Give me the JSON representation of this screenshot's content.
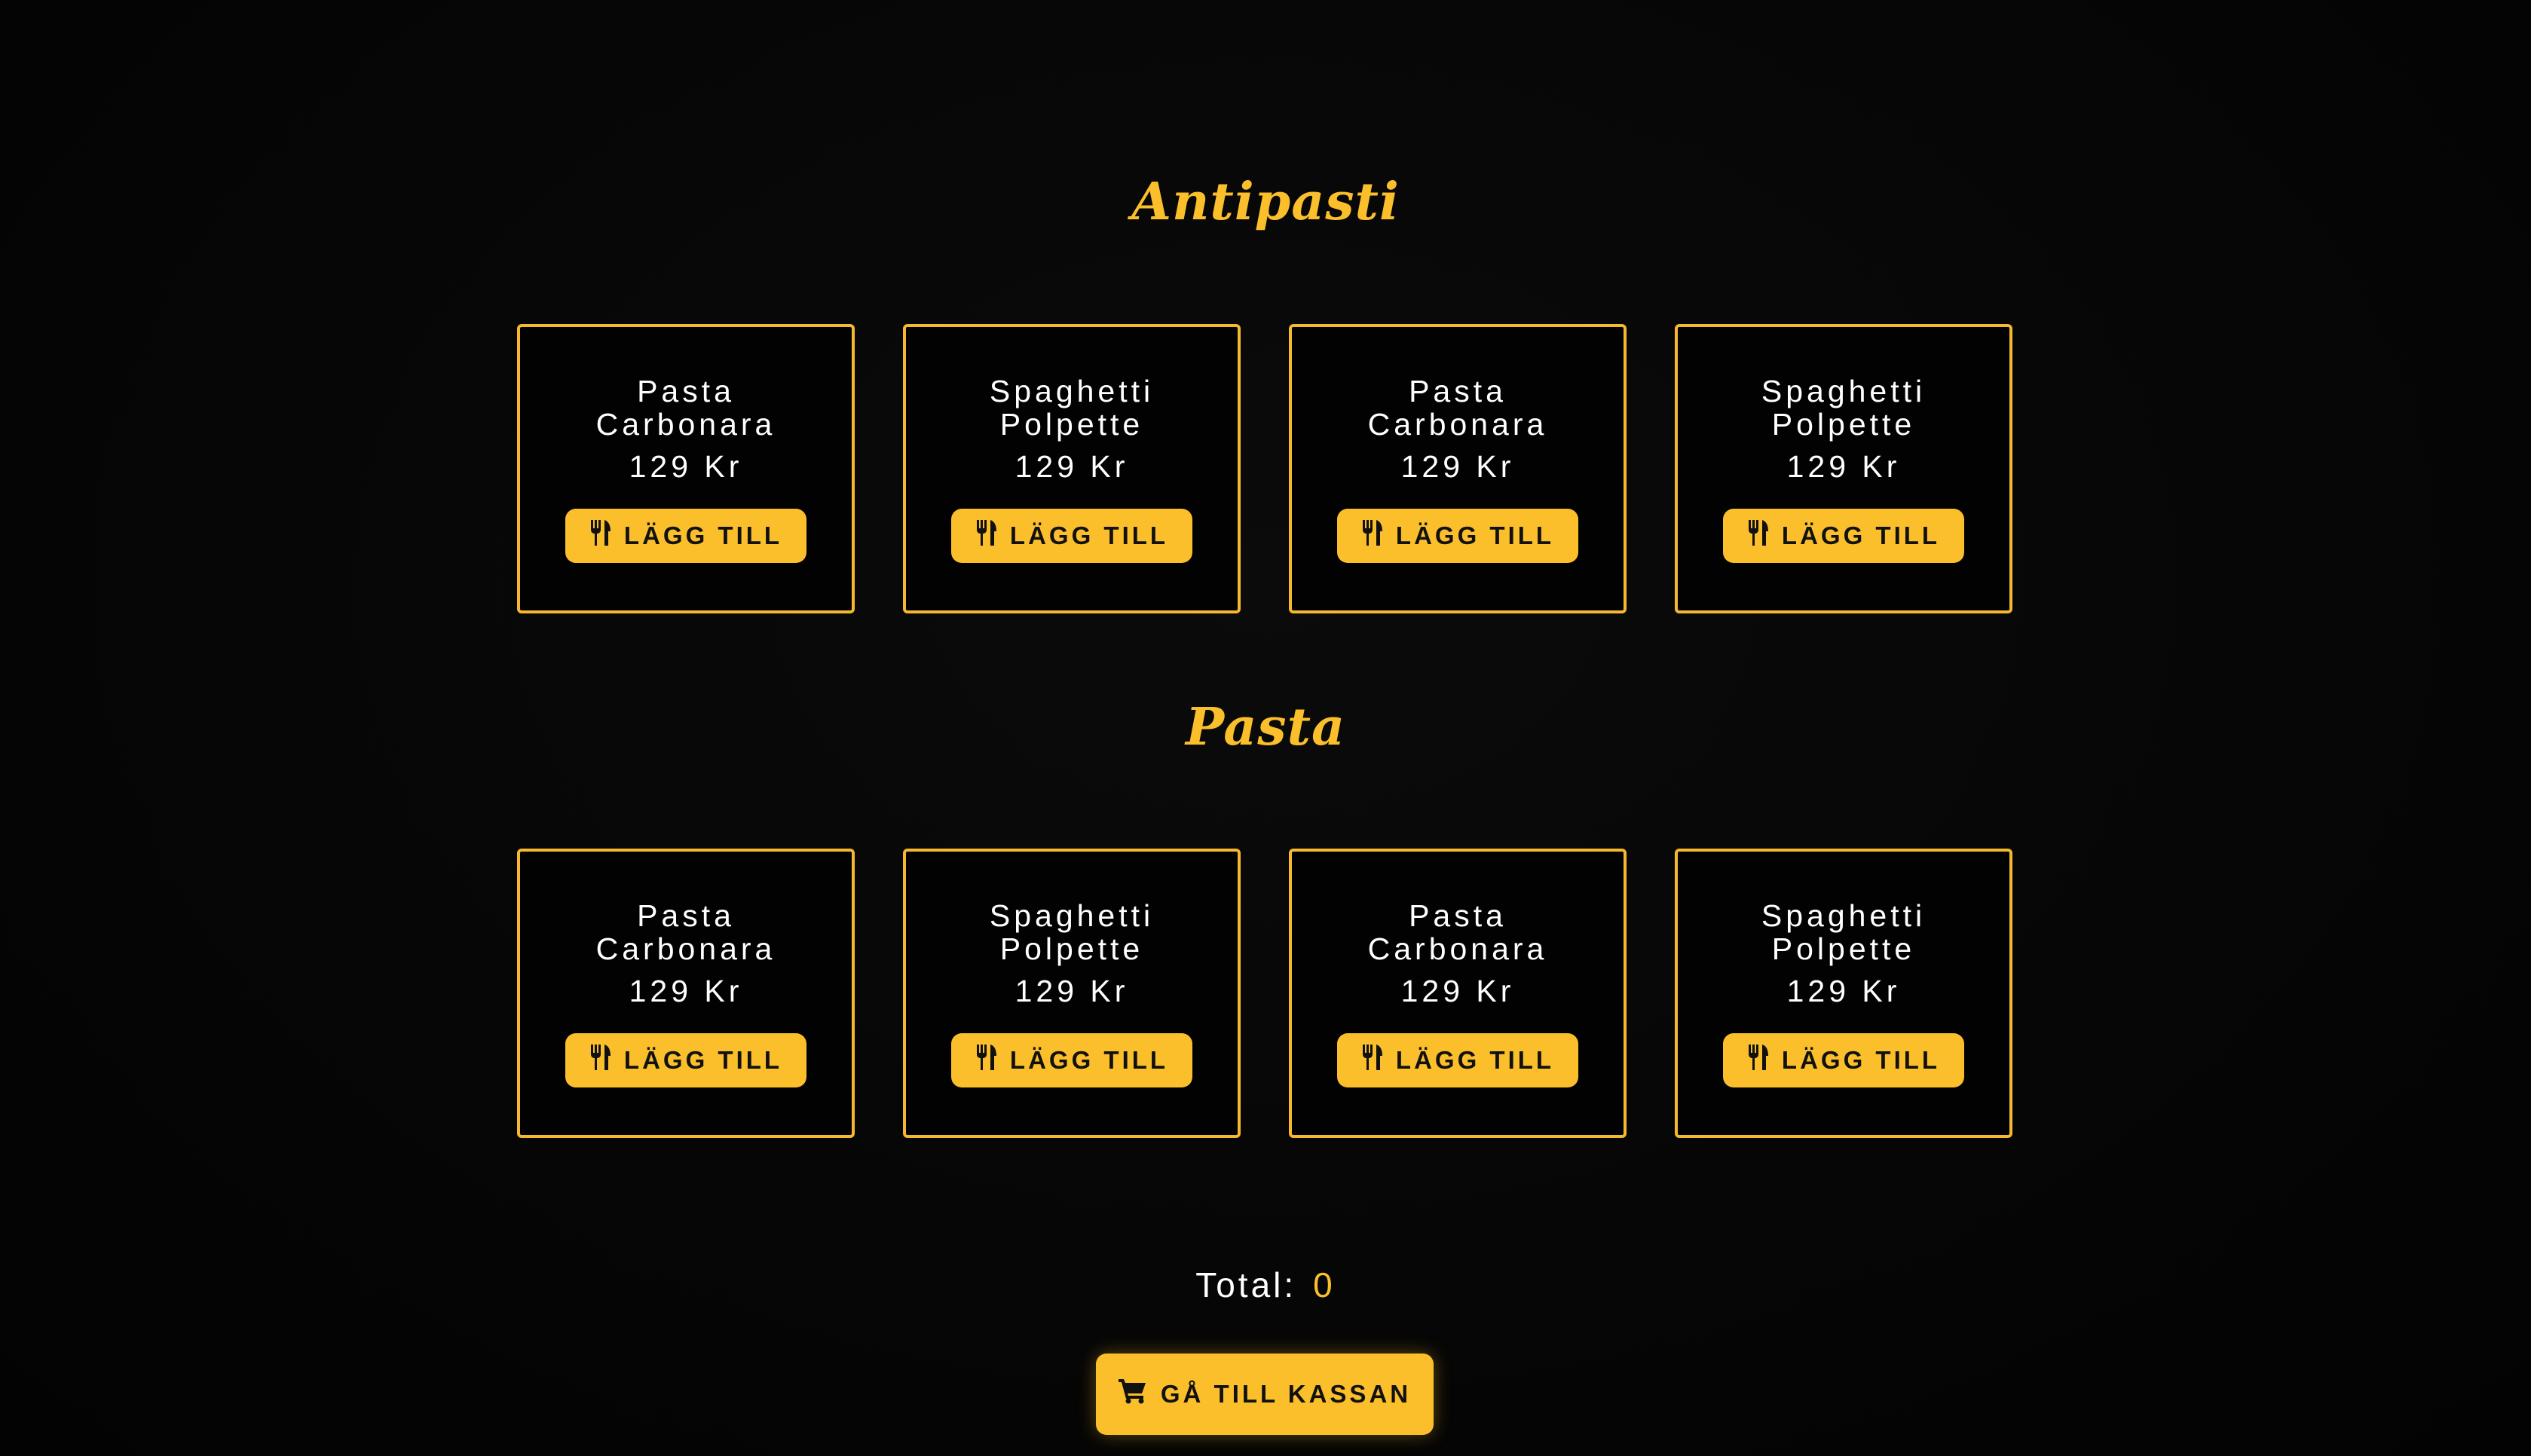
{
  "sections": [
    {
      "title": "Antipasti",
      "items": [
        {
          "name": "Pasta Carbonara",
          "price": "129 Kr",
          "button_label": "LÄGG TILL"
        },
        {
          "name": "Spaghetti Polpette",
          "price": "129 Kr",
          "button_label": "LÄGG TILL"
        },
        {
          "name": "Pasta Carbonara",
          "price": "129 Kr",
          "button_label": "LÄGG TILL"
        },
        {
          "name": "Spaghetti Polpette",
          "price": "129 Kr",
          "button_label": "LÄGG TILL"
        }
      ]
    },
    {
      "title": "Pasta",
      "items": [
        {
          "name": "Pasta Carbonara",
          "price": "129 Kr",
          "button_label": "LÄGG TILL"
        },
        {
          "name": "Spaghetti Polpette",
          "price": "129 Kr",
          "button_label": "LÄGG TILL"
        },
        {
          "name": "Pasta Carbonara",
          "price": "129 Kr",
          "button_label": "LÄGG TILL"
        },
        {
          "name": "Spaghetti Polpette",
          "price": "129 Kr",
          "button_label": "LÄGG TILL"
        }
      ]
    }
  ],
  "total": {
    "label": "Total:",
    "value": "0"
  },
  "checkout": {
    "label": "GÅ TILL KASSAN",
    "icon": "cart-icon"
  },
  "icons": {
    "add_button": "utensils-icon"
  },
  "colors": {
    "accent": "#fbbf2b",
    "background": "#050505",
    "text": "#ffffff"
  }
}
